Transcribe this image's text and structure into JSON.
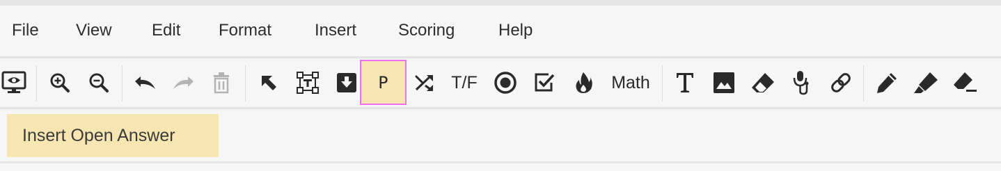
{
  "menu": {
    "items": [
      {
        "label": "File"
      },
      {
        "label": "View"
      },
      {
        "label": "Edit"
      },
      {
        "label": "Format"
      },
      {
        "label": "Insert"
      },
      {
        "label": "Scoring"
      },
      {
        "label": "Help"
      }
    ]
  },
  "toolbar": {
    "tools": [
      {
        "icon": "preview-icon",
        "state": "enabled"
      },
      {
        "icon": "zoom-in-icon",
        "state": "enabled"
      },
      {
        "icon": "zoom-out-icon",
        "state": "enabled"
      },
      {
        "icon": "undo-icon",
        "state": "enabled"
      },
      {
        "icon": "redo-icon",
        "state": "disabled"
      },
      {
        "icon": "trash-icon",
        "state": "disabled"
      },
      {
        "icon": "select-pointer-icon",
        "state": "enabled"
      },
      {
        "icon": "text-box-icon",
        "state": "enabled"
      },
      {
        "icon": "dropdown-icon",
        "state": "enabled"
      },
      {
        "icon": "open-answer-icon",
        "label": "P",
        "state": "active"
      },
      {
        "icon": "shuffle-icon",
        "state": "enabled"
      },
      {
        "icon": "true-false",
        "label": "T/F",
        "state": "enabled"
      },
      {
        "icon": "radio-button-icon",
        "state": "enabled"
      },
      {
        "icon": "checkbox-icon",
        "state": "enabled"
      },
      {
        "icon": "flame-icon",
        "state": "enabled"
      },
      {
        "icon": "math",
        "label": "Math",
        "state": "enabled"
      },
      {
        "icon": "text-icon",
        "state": "enabled"
      },
      {
        "icon": "image-icon",
        "state": "enabled"
      },
      {
        "icon": "eraser-icon",
        "state": "enabled"
      },
      {
        "icon": "microphone-icon",
        "state": "enabled"
      },
      {
        "icon": "link-icon",
        "state": "enabled"
      },
      {
        "icon": "pencil-icon",
        "state": "enabled"
      },
      {
        "icon": "highlighter-icon",
        "state": "enabled"
      },
      {
        "icon": "erase-drawing-icon",
        "state": "enabled"
      }
    ]
  },
  "tooltip": {
    "text": "Insert Open Answer"
  },
  "colors": {
    "active_background": "#f7e6b1",
    "active_border": "#f26ef2",
    "tooltip_background": "#f7e6b1"
  }
}
